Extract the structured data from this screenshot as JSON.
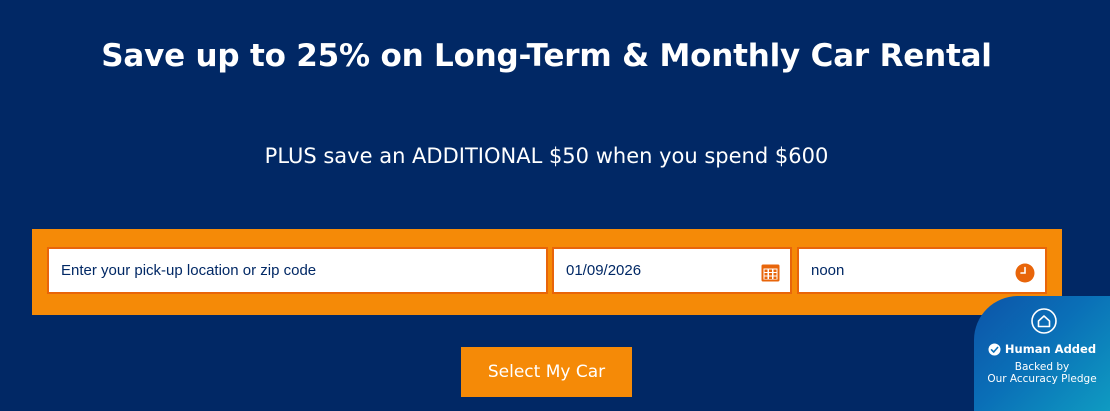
{
  "hero": {
    "headline": "Save up to 25% on Long-Term & Monthly Car Rental",
    "subline": "PLUS save an ADDITIONAL $50 when you spend $600"
  },
  "search": {
    "location_placeholder": "Enter your pick-up location or zip code",
    "date_value": "01/09/2026",
    "time_value": "noon",
    "submit_label": "Select My Car"
  },
  "badge": {
    "title": "Human Added",
    "line1": "Backed by",
    "line2": "Our Accuracy Pledge"
  },
  "colors": {
    "background": "#012865",
    "accent": "#f58a07",
    "icon_accent": "#e8650a"
  },
  "icons": [
    "calendar-icon",
    "clock-icon",
    "house-icon",
    "checkmark-icon"
  ]
}
